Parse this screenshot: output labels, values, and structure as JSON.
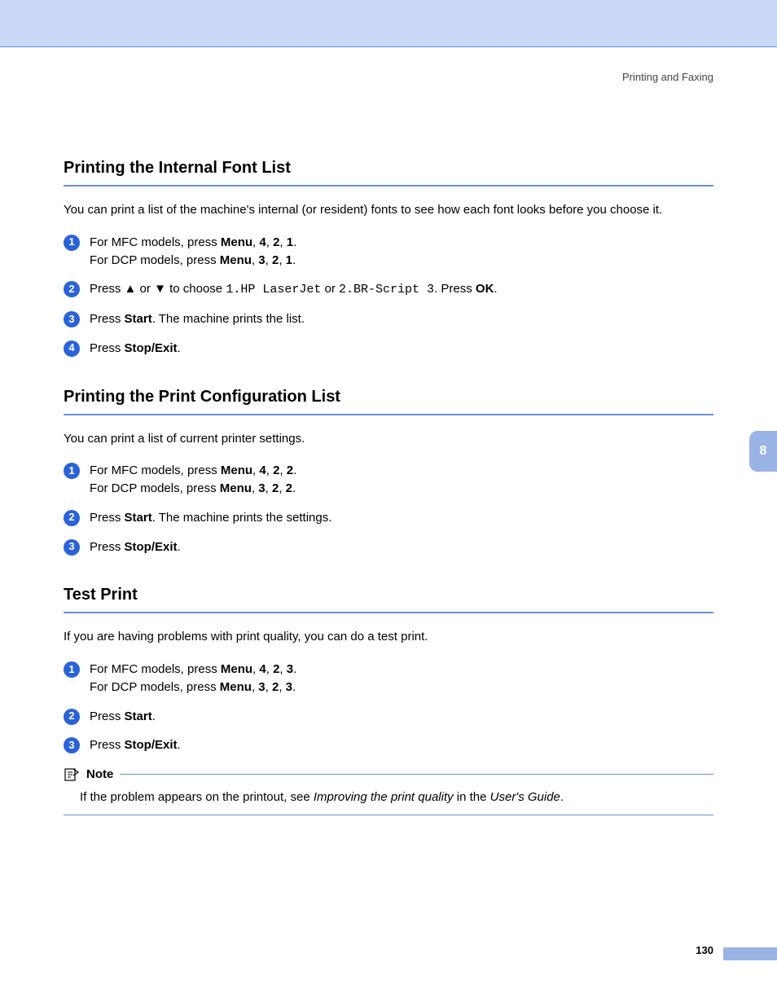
{
  "header": {
    "section_label": "Printing and Faxing"
  },
  "side_tab": "8",
  "page_number": "130",
  "sections": {
    "font_list": {
      "title": "Printing the Internal Font List",
      "intro": "You can print a list of the machine's internal (or resident) fonts to see how each font looks before you choose it.",
      "step1_a_pre": "For MFC models, press ",
      "step1_b_pre": "For DCP models, press ",
      "menu": "Menu",
      "s1a_n1": "4",
      "s1a_n2": "2",
      "s1a_n3": "1",
      "s1b_n1": "3",
      "s1b_n2": "2",
      "s1b_n3": "1",
      "step2_pre": "Press ",
      "step2_mid": " or ",
      "step2_choose": " to choose ",
      "opt1": "1.HP LaserJet",
      "step2_or": " or ",
      "opt2": "2.BR-Script 3",
      "step2_pressok_pre": ". Press ",
      "ok": "OK",
      "step3_pre": "Press ",
      "start": "Start",
      "step3_post": ". The machine prints the list.",
      "step4_pre": "Press ",
      "stopexit": "Stop/Exit"
    },
    "config_list": {
      "title": "Printing the Print Configuration List",
      "intro": "You can print a list of current printer settings.",
      "s1a_n1": "4",
      "s1a_n2": "2",
      "s1a_n3": "2",
      "s1b_n1": "3",
      "s1b_n2": "2",
      "s1b_n3": "2",
      "step2_post": ". The machine prints the settings."
    },
    "test_print": {
      "title": "Test Print",
      "intro": "If you are having problems with print quality, you can do a test print.",
      "s1a_n1": "4",
      "s1a_n2": "2",
      "s1a_n3": "3",
      "s1b_n1": "3",
      "s1b_n2": "2",
      "s1b_n3": "3",
      "note_label": "Note",
      "note_pre": "If the problem appears on the printout, see ",
      "note_ital1": "Improving the print quality",
      "note_mid": " in the ",
      "note_ital2": "User's Guide",
      "note_post": "."
    }
  }
}
